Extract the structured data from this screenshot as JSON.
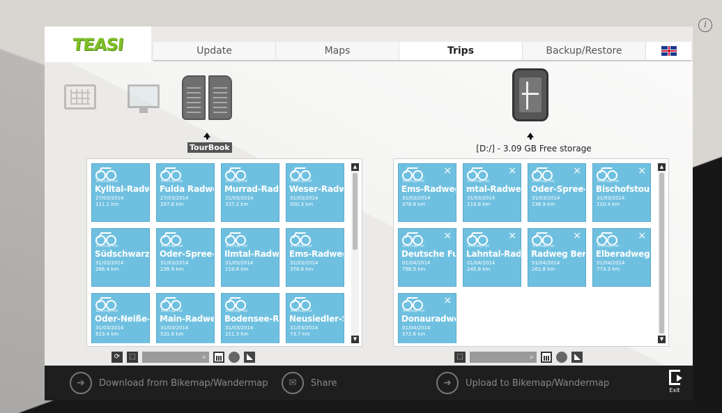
{
  "app": {
    "logo_text": "TEASI"
  },
  "tabs": [
    {
      "label": "Update"
    },
    {
      "label": "Maps"
    },
    {
      "label": "Trips"
    },
    {
      "label": "Backup/Restore"
    }
  ],
  "active_tab": "Trips",
  "language_icon": "uk-flag-icon",
  "info_icon": "info-icon",
  "tourbook_label": "TourBook",
  "device_storage": "[D:/] - 3.09 GB Free storage",
  "tile_brand": "bikemap.net",
  "left_tiles": [
    {
      "name": "Kylltal-Radweg",
      "date": "27/03/2014",
      "dist": "111.1 km"
    },
    {
      "name": "Fulda Radweg",
      "date": "27/03/2014",
      "dist": "297.8 km"
    },
    {
      "name": "Murrad-Radweg",
      "date": "31/03/2014",
      "dist": "337.2 km"
    },
    {
      "name": "Weser-Radweg",
      "date": "31/03/2014",
      "dist": "500.3 km"
    },
    {
      "name": "Südschwarzwald",
      "date": "31/03/2014",
      "dist": "266.4 km"
    },
    {
      "name": "Oder-Spree-Tour",
      "date": "31/03/2014",
      "dist": "236.9 km"
    },
    {
      "name": "Ilmtal-Radweg",
      "date": "31/03/2014",
      "dist": "119.8 km"
    },
    {
      "name": "Ems-Radweg",
      "date": "31/03/2014",
      "dist": "378.8 km"
    },
    {
      "name": "Oder-Neiße-Radweg",
      "date": "31/03/2014",
      "dist": "623.4 km"
    },
    {
      "name": "Main-Radweg",
      "date": "31/03/2014",
      "dist": "531.8 km"
    },
    {
      "name": "Bodensee-Radweg",
      "date": "31/03/2014",
      "dist": "211.3 km"
    },
    {
      "name": "Neusiedler-See",
      "date": "31/03/2014",
      "dist": "73.7 km"
    }
  ],
  "right_tiles": [
    {
      "name": "Ems-Radweg",
      "date": "31/03/2014",
      "dist": "378.8 km"
    },
    {
      "name": "mtal-Radweg",
      "date": "31/03/2014",
      "dist": "119.8 km"
    },
    {
      "name": "Oder-Spree-Tour",
      "date": "31/03/2014",
      "dist": "236.9 km"
    },
    {
      "name": "Bischofstour",
      "date": "31/03/2014",
      "dist": "110.4 km"
    },
    {
      "name": "Deutsche Fuhrt",
      "date": "01/04/2014",
      "dist": "798.5 km"
    },
    {
      "name": "Lahntal-Radweg",
      "date": "01/04/2014",
      "dist": "245.8 km"
    },
    {
      "name": "Radweg Berlin",
      "date": "01/04/2014",
      "dist": "261.8 km"
    },
    {
      "name": "Elberadweg",
      "date": "01/04/2014",
      "dist": "773.3 km"
    },
    {
      "name": "Donauradweg",
      "date": "01/04/2014",
      "dist": "372.6 km"
    }
  ],
  "actions": {
    "download": "Download from Bikemap/Wandermap",
    "share": "Share",
    "upload": "Upload to Bikemap/Wandermap",
    "exit": "Exit"
  },
  "colors": {
    "tile": "#6fc0e0",
    "logo_green": "#7fbf28",
    "action_bar": "#1e1e1e"
  }
}
